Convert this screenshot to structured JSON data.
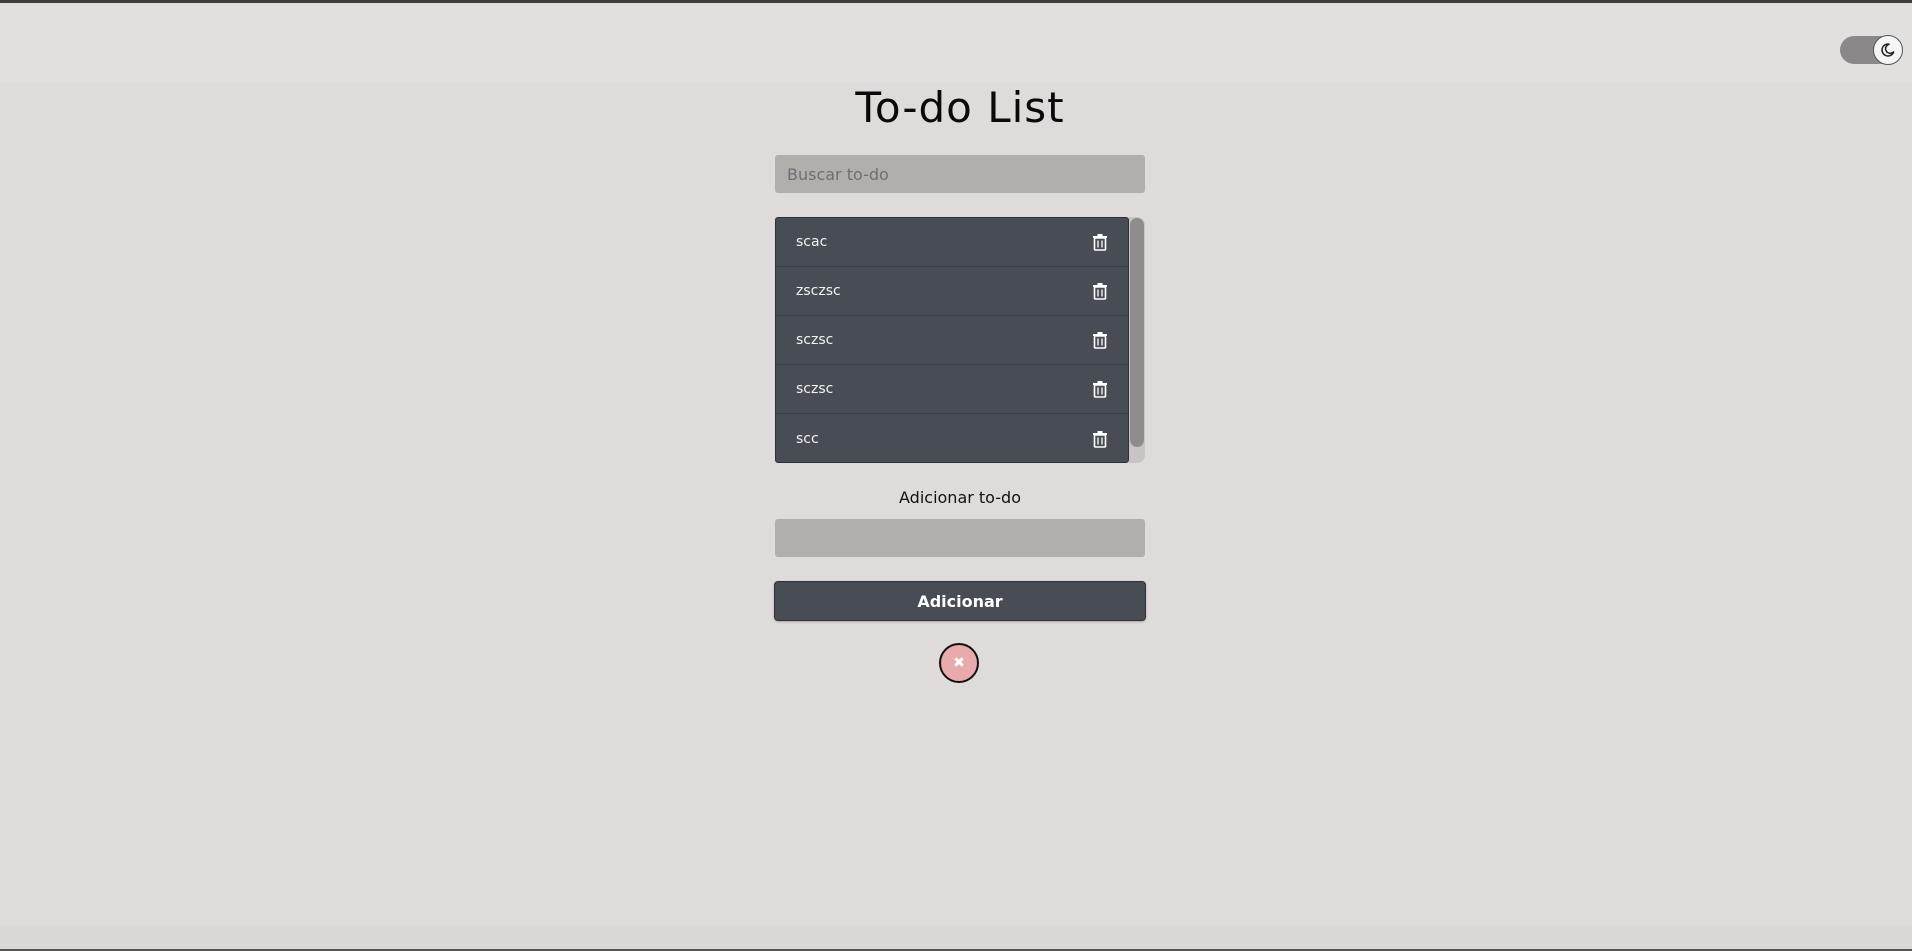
{
  "page": {
    "title": "To-do List"
  },
  "search": {
    "placeholder": "Buscar to-do"
  },
  "todos": [
    {
      "text": "scac"
    },
    {
      "text": "zsczsc"
    },
    {
      "text": "sczsc"
    },
    {
      "text": "sczsc"
    },
    {
      "text": "scc"
    }
  ],
  "add": {
    "label": "Adicionar to-do",
    "value": "",
    "button_label": "Adicionar"
  },
  "clear": {
    "symbol": "✖"
  },
  "icons": {
    "theme_toggle": "moon-icon",
    "delete": "trash-icon",
    "clear": "close-icon"
  },
  "colors": {
    "background": "#dfdbda",
    "list_background": "#484c54",
    "input_background": "#b2aeac",
    "clear_button": "#e8aaaa"
  }
}
